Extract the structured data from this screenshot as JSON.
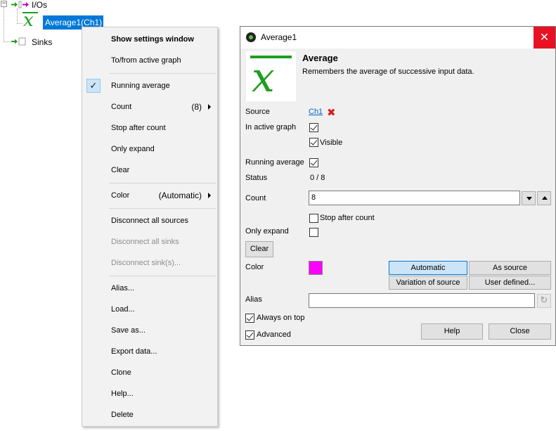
{
  "tree": {
    "ios_label": "I/Os",
    "selected_node_label": "Average1(Ch1)",
    "sinks_label": "Sinks"
  },
  "context_menu": {
    "items": [
      {
        "label": "Show settings window"
      },
      {
        "label": "To/from active graph"
      },
      {
        "label": "Running average",
        "checked": true
      },
      {
        "label": "Count",
        "extra": "(8)"
      },
      {
        "label": "Stop after count"
      },
      {
        "label": "Only expand"
      },
      {
        "label": "Clear"
      },
      {
        "label": "Color",
        "extra": "(Automatic)"
      },
      {
        "label": "Disconnect all sources"
      },
      {
        "label": "Disconnect all sinks",
        "disabled": true
      },
      {
        "label": "Disconnect sink(s)...",
        "disabled": true
      },
      {
        "label": "Alias..."
      },
      {
        "label": "Load..."
      },
      {
        "label": "Save as..."
      },
      {
        "label": "Export data..."
      },
      {
        "label": "Clone"
      },
      {
        "label": "Help..."
      },
      {
        "label": "Delete"
      }
    ]
  },
  "dialog": {
    "window_title": "Average1",
    "header_title": "Average",
    "header_description": "Remembers the average of successive input data.",
    "source_label": "Source",
    "source_value": "Ch1",
    "in_active_graph_label": "In active graph",
    "in_active_graph_checked": true,
    "visible_label": "Visible",
    "visible_checked": true,
    "running_average_label": "Running average",
    "running_average_checked": true,
    "status_label": "Status",
    "status_value": "0 / 8",
    "count_label": "Count",
    "count_value": "8",
    "stop_after_count_label": "Stop after count",
    "stop_after_count_checked": false,
    "only_expand_label": "Only expand",
    "only_expand_checked": false,
    "clear_button": "Clear",
    "color_label": "Color",
    "color_value": "#ff00ff",
    "color_buttons": {
      "automatic": "Automatic",
      "as_source": "As source",
      "variation_of_source": "Variation of source",
      "user_defined": "User defined..."
    },
    "alias_label": "Alias",
    "alias_value": "",
    "always_on_top_label": "Always on top",
    "always_on_top_checked": true,
    "advanced_label": "Advanced",
    "advanced_checked": true,
    "help_button": "Help",
    "close_button": "Close"
  },
  "colors": {
    "accent_green": "#1e9e1e",
    "selection_blue": "#0078d7",
    "close_red": "#e81123",
    "swatch_magenta": "#ff00ff"
  },
  "icons": [
    "tree-expander-icon",
    "arrow-right-icon",
    "x-variable-icon",
    "checkmark-icon",
    "submenu-arrow-icon",
    "close-icon",
    "red-x-icon",
    "spin-down-icon",
    "spin-up-icon",
    "reset-icon",
    "app-icon"
  ]
}
